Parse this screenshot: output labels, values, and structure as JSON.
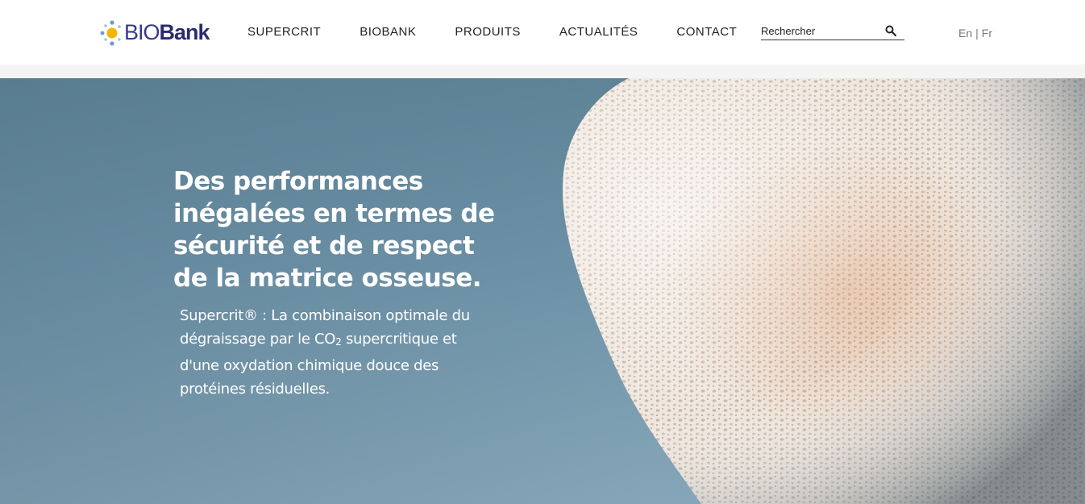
{
  "brand": {
    "logo_bio": "BIO",
    "logo_bank": "Bank",
    "colors": {
      "navy": "#2b2b6e",
      "yellow": "#f2b705",
      "blue_dots": "#5b8fd6"
    }
  },
  "nav": {
    "items": [
      {
        "label": "SUPERCRIT"
      },
      {
        "label": "BIOBANK"
      },
      {
        "label": "PRODUITS"
      },
      {
        "label": "ACTUALITÉS"
      },
      {
        "label": "CONTACT"
      }
    ]
  },
  "search": {
    "placeholder": "Rechercher",
    "icon": "search-icon"
  },
  "language": {
    "en": "En",
    "separator": "|",
    "fr": "Fr"
  },
  "hero": {
    "title": "Des performances inégalées en termes de sécurité et de respect de la matrice osseuse.",
    "subtitle_part1": "Supercrit® : La combinaison optimale du dégraissage par le CO",
    "subtitle_subscript": "2",
    "subtitle_part2": " supercritique et d'une oxydation chimique douce des protéines résiduelles.",
    "image": "porous-bone-sponge",
    "background_color": "#6e93a8"
  }
}
